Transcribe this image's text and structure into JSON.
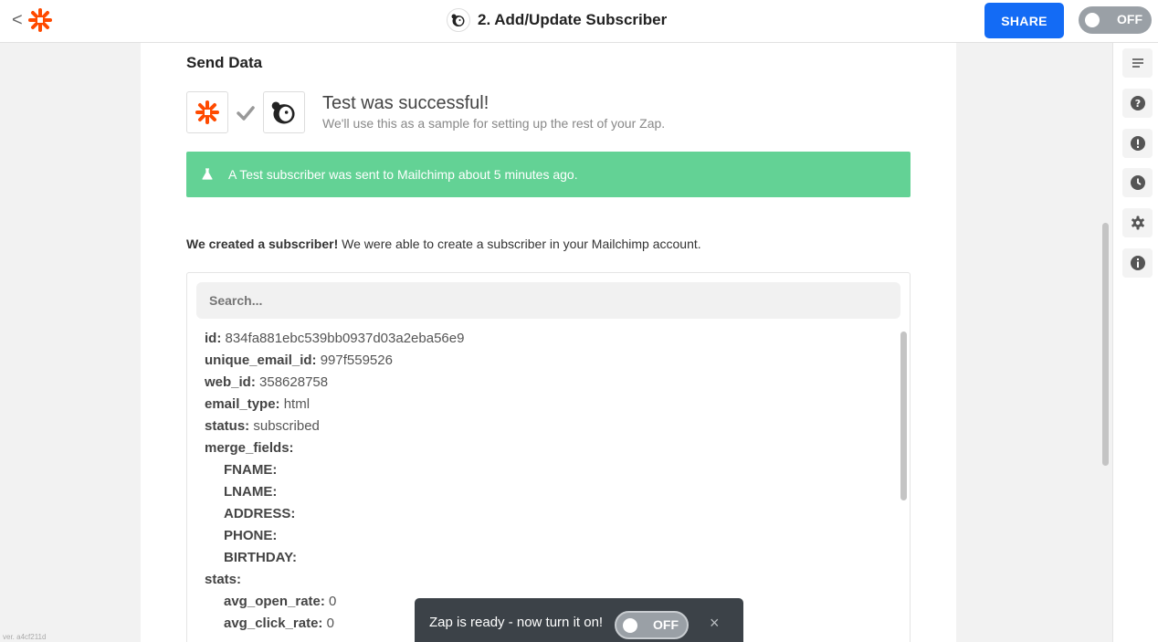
{
  "topbar": {
    "back_glyph": "<",
    "title": "2. Add/Update Subscriber",
    "share_label": "SHARE",
    "toggle_label": "OFF",
    "app_icon": "mailchimp-icon",
    "logo_icon": "zapier-logo"
  },
  "step": {
    "heading": "Send Data",
    "success_title": "Test was successful!",
    "success_subtitle": "We'll use this as a sample for setting up the rest of your Zap.",
    "banner_text": "A Test subscriber was sent to Mailchimp about 5 minutes ago.",
    "banner_color": "#63d295",
    "created_bold": "We created a subscriber!",
    "created_rest": " We were able to create a subscriber in your Mailchimp account."
  },
  "search": {
    "placeholder": "Search..."
  },
  "fields": [
    {
      "key": "id:",
      "value": " 834fa881ebc539bb0937d03a2eba56e9",
      "indent": false
    },
    {
      "key": "unique_email_id:",
      "value": " 997f559526",
      "indent": false
    },
    {
      "key": "web_id:",
      "value": " 358628758",
      "indent": false
    },
    {
      "key": "email_type:",
      "value": " html",
      "indent": false
    },
    {
      "key": "status:",
      "value": " subscribed",
      "indent": false
    },
    {
      "key": "merge_fields:",
      "value": "",
      "indent": false
    },
    {
      "key": "FNAME:",
      "value": "",
      "indent": true
    },
    {
      "key": "LNAME:",
      "value": "",
      "indent": true
    },
    {
      "key": "ADDRESS:",
      "value": "",
      "indent": true
    },
    {
      "key": "PHONE:",
      "value": "",
      "indent": true
    },
    {
      "key": "BIRTHDAY:",
      "value": "",
      "indent": true
    },
    {
      "key": "stats:",
      "value": "",
      "indent": false
    },
    {
      "key": "avg_open_rate:",
      "value": " 0",
      "indent": true
    },
    {
      "key": "avg_click_rate:",
      "value": " 0",
      "indent": true
    }
  ],
  "sidebar": {
    "icons": [
      "notes-icon",
      "help-icon",
      "alert-icon",
      "history-icon",
      "settings-icon",
      "info-icon"
    ]
  },
  "toast": {
    "message": "Zap is ready - now turn it on!",
    "toggle_label": "OFF",
    "close_glyph": "×"
  },
  "footer": {
    "version": "ver. a4cf211d"
  },
  "colors": {
    "brand_orange": "#ff4a00",
    "share_blue": "#136bf5"
  }
}
